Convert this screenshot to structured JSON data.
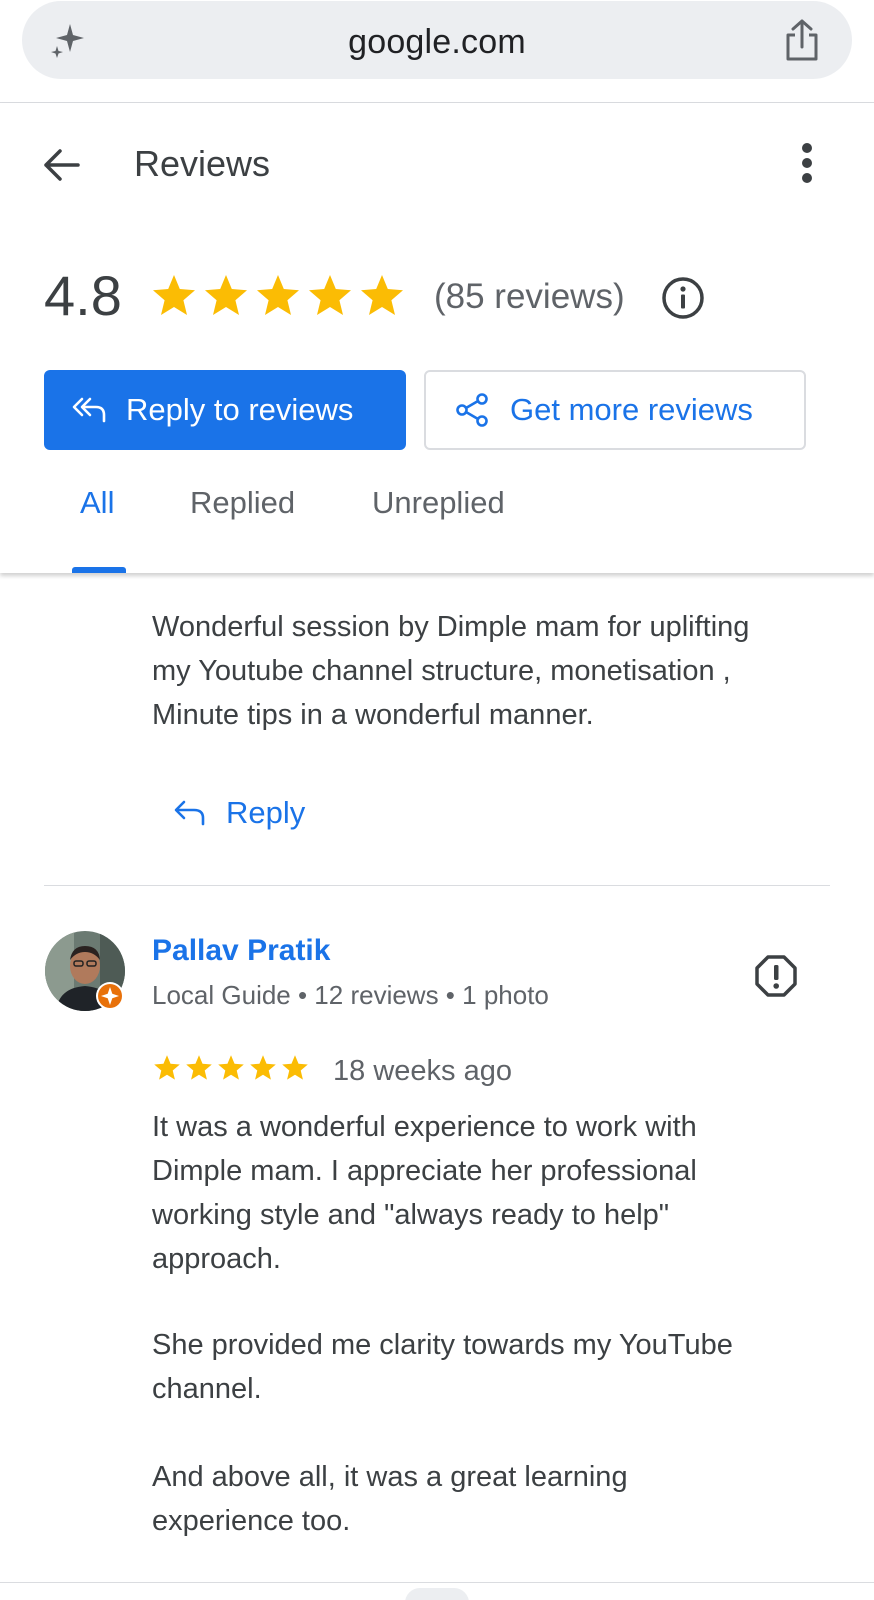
{
  "browser": {
    "url": "google.com",
    "sparkle_icon": "sparkle-icon",
    "share_icon": "share-icon"
  },
  "header": {
    "title": "Reviews",
    "back_icon": "arrow-back-icon",
    "more_icon": "more-vert-icon"
  },
  "summary": {
    "rating": "4.8",
    "stars": 5,
    "review_count": "(85 reviews)",
    "info_icon": "info-icon"
  },
  "actions": {
    "reply_label": "Reply to reviews",
    "more_label": "Get more reviews"
  },
  "tabs": [
    {
      "label": "All",
      "active": true
    },
    {
      "label": "Replied",
      "active": false
    },
    {
      "label": "Unreplied",
      "active": false
    }
  ],
  "reviews": [
    {
      "text_lines": [
        "Wonderful session by Dimple mam for uplifting",
        "my Youtube channel structure, monetisation ,",
        "Minute tips in a wonderful manner."
      ],
      "reply_label": "Reply"
    },
    {
      "name": "Pallav Pratik",
      "meta": "Local Guide • 12 reviews • 1 photo",
      "stars": 5,
      "date": "18 weeks ago",
      "paragraphs": [
        [
          "It was a wonderful experience to work with",
          "Dimple mam. I appreciate her professional",
          "working style and \"always ready to help\"",
          "approach."
        ],
        [
          "She provided me clarity towards my YouTube",
          "channel."
        ],
        [
          "And above all, it was a great learning",
          "experience too."
        ]
      ]
    }
  ],
  "colors": {
    "accent": "#1a73e8",
    "star": "#fbbc04",
    "text": "#3c4043",
    "muted": "#5f6368"
  }
}
